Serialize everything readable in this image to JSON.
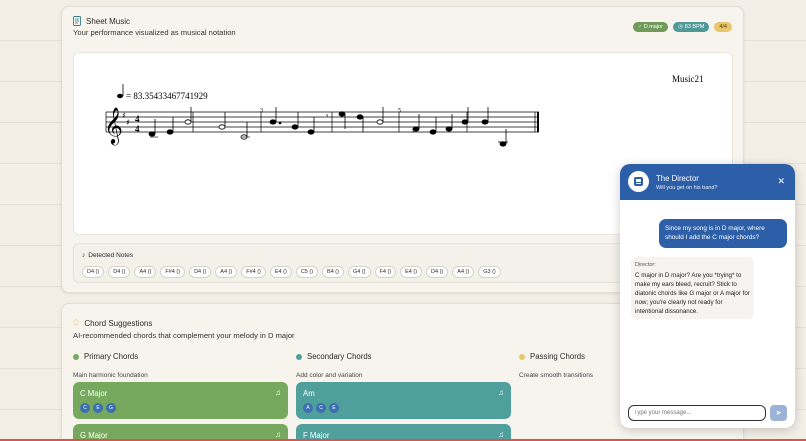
{
  "sheet": {
    "title": "Sheet Music",
    "subtitle": "Your performance visualized as musical notation",
    "badges": {
      "key": "D major",
      "bpm": "83 BPM",
      "time": "4/4"
    },
    "score": {
      "tempo_text": "= 83.35433467741929",
      "composer": "Music21",
      "measure_numbers": [
        "3",
        "5"
      ]
    }
  },
  "detected": {
    "title": "Detected Notes",
    "notes": [
      "D4 ()",
      "D4 ()",
      "A4 ()",
      "F#4 ()",
      "D4 ()",
      "A4 ()",
      "F#4 ()",
      "E4 ()",
      "C5 ()",
      "B4 ()",
      "G4 ()",
      "F4 ()",
      "E4 ()",
      "D4 ()",
      "A4 ()",
      "G3 ()"
    ]
  },
  "chords": {
    "title": "Chord Suggestions",
    "subtitle": "AI-recommended chords that complement your melody in D major",
    "columns": [
      {
        "title": "Primary Chords",
        "subtitle": "Main harmonic foundation",
        "color": "#76a85e",
        "items": [
          {
            "name": "C Major",
            "tones": [
              "C",
              "E",
              "G"
            ]
          },
          {
            "name": "G Major",
            "tones": []
          }
        ]
      },
      {
        "title": "Secondary Chords",
        "subtitle": "Add color and variation",
        "color": "#4f9f9c",
        "items": [
          {
            "name": "Am",
            "tones": [
              "A",
              "C",
              "E"
            ]
          },
          {
            "name": "F Major",
            "tones": []
          }
        ]
      },
      {
        "title": "Passing Chords",
        "subtitle": "Create smooth transitions",
        "color": "#e9c56b",
        "items": []
      }
    ]
  },
  "chat": {
    "title": "The Director",
    "subtitle": "Will you get on his band?",
    "user_message": "Since my song is in D major, where should I add the C major chords?",
    "bot_name": "Director:",
    "bot_message": "C major in D major? Are you *trying* to make my ears bleed, recruit? Stick to diatonic chords like G major or A major for now; you're clearly not ready for intentional dissonance.",
    "input_placeholder": "Type your message..."
  }
}
